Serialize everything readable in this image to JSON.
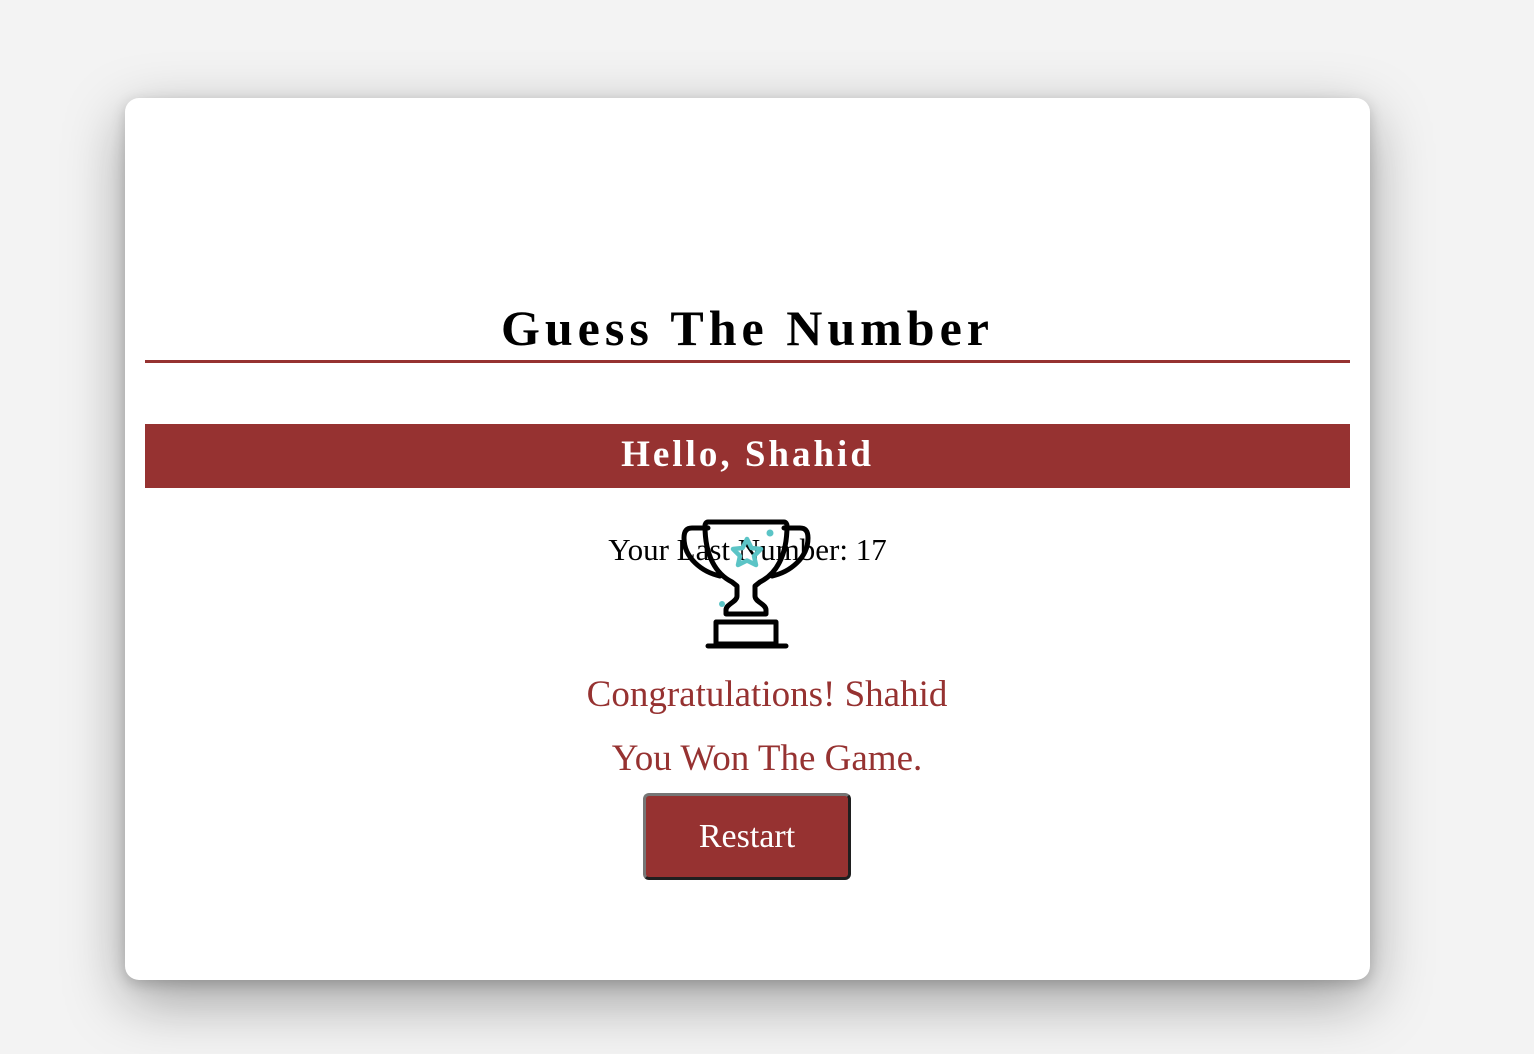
{
  "game": {
    "title": "Guess The Number",
    "greeting": "Hello, Shahid",
    "last_number_text": "Your Last Number: 17",
    "congrats_line1": "Congratulations! Shahid",
    "congrats_line2": "You Won The Game.",
    "restart_label": "Restart",
    "icon": "trophy-icon"
  },
  "colors": {
    "accent": "#963231",
    "background": "#f3f3f3",
    "card": "#ffffff",
    "star": "#5bc4c6"
  }
}
